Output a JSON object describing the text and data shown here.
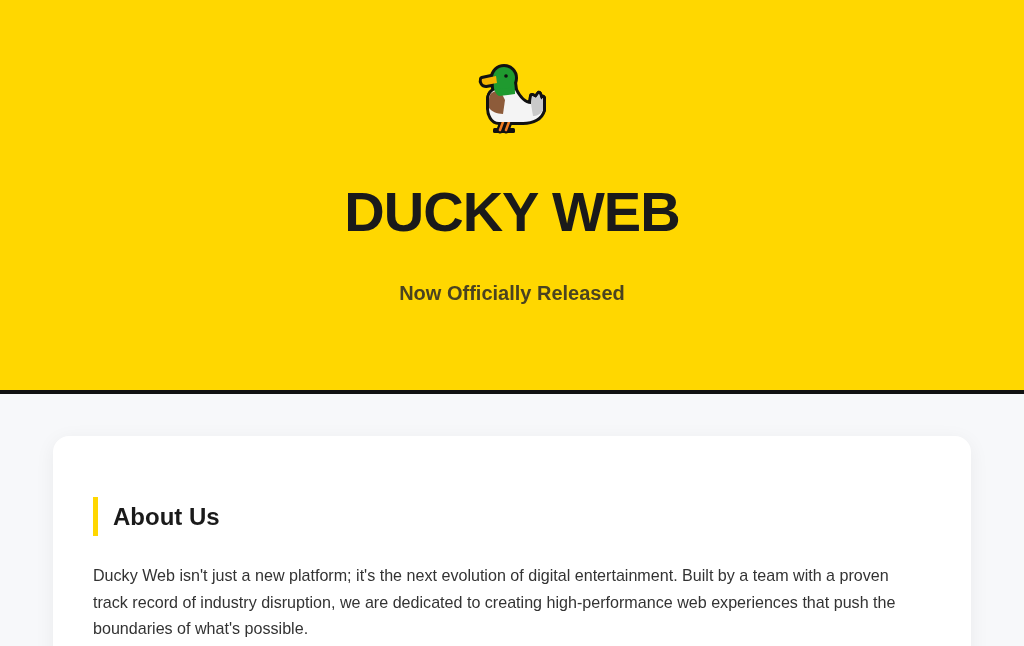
{
  "header": {
    "title": "DUCKY WEB",
    "subtitle": "Now Officially Released"
  },
  "about": {
    "heading": "About Us",
    "body": "Ducky Web isn't just a new platform; it's the next evolution of digital entertainment. Built by a team with a proven track record of industry disruption, we are dedicated to creating high-performance web experiences that push the boundaries of what's possible."
  }
}
